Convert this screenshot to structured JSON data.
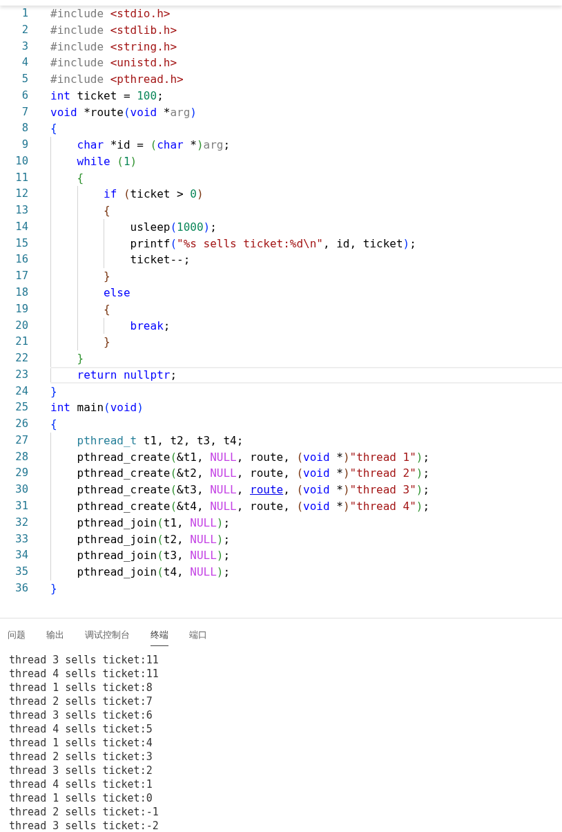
{
  "editor": {
    "lines": [
      {
        "number": "1",
        "current": false,
        "tokens": [
          {
            "kind": "pre",
            "text": "#include "
          },
          {
            "kind": "hdr",
            "text": "<stdio.h>"
          }
        ]
      },
      {
        "number": "2",
        "current": false,
        "tokens": [
          {
            "kind": "pre",
            "text": "#include "
          },
          {
            "kind": "hdr",
            "text": "<stdlib.h>"
          }
        ]
      },
      {
        "number": "3",
        "current": false,
        "tokens": [
          {
            "kind": "pre",
            "text": "#include "
          },
          {
            "kind": "hdr",
            "text": "<string.h>"
          }
        ]
      },
      {
        "number": "4",
        "current": false,
        "tokens": [
          {
            "kind": "pre",
            "text": "#include "
          },
          {
            "kind": "hdr",
            "text": "<unistd.h>"
          }
        ]
      },
      {
        "number": "5",
        "current": false,
        "tokens": [
          {
            "kind": "pre",
            "text": "#include "
          },
          {
            "kind": "hdr",
            "text": "<pthread.h>"
          }
        ]
      },
      {
        "number": "6",
        "current": false,
        "tokens": [
          {
            "kind": "kw",
            "text": "int"
          },
          {
            "kind": "plain",
            "text": " ticket = "
          },
          {
            "kind": "num",
            "text": "100"
          },
          {
            "kind": "plain",
            "text": ";"
          }
        ]
      },
      {
        "number": "7",
        "current": false,
        "tokens": [
          {
            "kind": "kw",
            "text": "void"
          },
          {
            "kind": "plain",
            "text": " *route"
          },
          {
            "kind": "b1",
            "text": "("
          },
          {
            "kind": "kw",
            "text": "void"
          },
          {
            "kind": "plain",
            "text": " *"
          },
          {
            "kind": "param",
            "text": "arg"
          },
          {
            "kind": "b1",
            "text": ")"
          }
        ]
      },
      {
        "number": "8",
        "current": false,
        "tokens": [
          {
            "kind": "b1",
            "text": "{"
          }
        ]
      },
      {
        "number": "9",
        "current": false,
        "tokens": [
          {
            "kind": "kw",
            "text": "    char"
          },
          {
            "kind": "plain",
            "text": " *id = "
          },
          {
            "kind": "b2",
            "text": "("
          },
          {
            "kind": "kw",
            "text": "char"
          },
          {
            "kind": "plain",
            "text": " *"
          },
          {
            "kind": "b2",
            "text": ")"
          },
          {
            "kind": "param",
            "text": "arg"
          },
          {
            "kind": "plain",
            "text": ";"
          }
        ]
      },
      {
        "number": "10",
        "current": false,
        "tokens": [
          {
            "kind": "kw",
            "text": "    while "
          },
          {
            "kind": "b2",
            "text": "("
          },
          {
            "kind": "num",
            "text": "1"
          },
          {
            "kind": "b2",
            "text": ")"
          }
        ]
      },
      {
        "number": "11",
        "current": false,
        "tokens": [
          {
            "kind": "b2",
            "text": "    {"
          }
        ]
      },
      {
        "number": "12",
        "current": false,
        "tokens": [
          {
            "kind": "kw",
            "text": "        if "
          },
          {
            "kind": "b3",
            "text": "("
          },
          {
            "kind": "plain",
            "text": "ticket > "
          },
          {
            "kind": "num",
            "text": "0"
          },
          {
            "kind": "b3",
            "text": ")"
          }
        ]
      },
      {
        "number": "13",
        "current": false,
        "tokens": [
          {
            "kind": "b3",
            "text": "        {"
          }
        ]
      },
      {
        "number": "14",
        "current": false,
        "tokens": [
          {
            "kind": "plain",
            "text": "            usleep"
          },
          {
            "kind": "b1",
            "text": "("
          },
          {
            "kind": "num",
            "text": "1000"
          },
          {
            "kind": "b1",
            "text": ")"
          },
          {
            "kind": "plain",
            "text": ";"
          }
        ]
      },
      {
        "number": "15",
        "current": false,
        "tokens": [
          {
            "kind": "plain",
            "text": "            printf"
          },
          {
            "kind": "b1",
            "text": "("
          },
          {
            "kind": "str",
            "text": "\"%s sells ticket:%d\\n\""
          },
          {
            "kind": "plain",
            "text": ", id, ticket"
          },
          {
            "kind": "b1",
            "text": ")"
          },
          {
            "kind": "plain",
            "text": ";"
          }
        ]
      },
      {
        "number": "16",
        "current": false,
        "tokens": [
          {
            "kind": "plain",
            "text": "            ticket--;"
          }
        ]
      },
      {
        "number": "17",
        "current": false,
        "tokens": [
          {
            "kind": "b3",
            "text": "        }"
          }
        ]
      },
      {
        "number": "18",
        "current": false,
        "tokens": [
          {
            "kind": "kw",
            "text": "        else"
          }
        ]
      },
      {
        "number": "19",
        "current": false,
        "tokens": [
          {
            "kind": "b3",
            "text": "        {"
          }
        ]
      },
      {
        "number": "20",
        "current": false,
        "tokens": [
          {
            "kind": "kw",
            "text": "            break"
          },
          {
            "kind": "plain",
            "text": ";"
          }
        ]
      },
      {
        "number": "21",
        "current": false,
        "tokens": [
          {
            "kind": "b3",
            "text": "        }"
          }
        ]
      },
      {
        "number": "22",
        "current": false,
        "tokens": [
          {
            "kind": "b2",
            "text": "    }"
          }
        ]
      },
      {
        "number": "23",
        "current": true,
        "tokens": [
          {
            "kind": "kw",
            "text": "    return "
          },
          {
            "kind": "kw",
            "text": "nullptr"
          },
          {
            "kind": "plain",
            "text": ";"
          }
        ]
      },
      {
        "number": "24",
        "current": false,
        "tokens": [
          {
            "kind": "b1",
            "text": "}"
          }
        ]
      },
      {
        "number": "25",
        "current": false,
        "tokens": [
          {
            "kind": "kw",
            "text": "int"
          },
          {
            "kind": "plain",
            "text": " main"
          },
          {
            "kind": "b1",
            "text": "("
          },
          {
            "kind": "kw",
            "text": "void"
          },
          {
            "kind": "b1",
            "text": ")"
          }
        ]
      },
      {
        "number": "26",
        "current": false,
        "tokens": [
          {
            "kind": "b1",
            "text": "{"
          }
        ]
      },
      {
        "number": "27",
        "current": false,
        "tokens": [
          {
            "kind": "type",
            "text": "    pthread_t"
          },
          {
            "kind": "plain",
            "text": " t1, t2, t3, t4;"
          }
        ]
      },
      {
        "number": "28",
        "current": false,
        "tokens": [
          {
            "kind": "plain",
            "text": "    pthread_create"
          },
          {
            "kind": "b2",
            "text": "("
          },
          {
            "kind": "plain",
            "text": "&t1, "
          },
          {
            "kind": "macro",
            "text": "NULL"
          },
          {
            "kind": "plain",
            "text": ", route, "
          },
          {
            "kind": "b3",
            "text": "("
          },
          {
            "kind": "kw",
            "text": "void"
          },
          {
            "kind": "plain",
            "text": " *"
          },
          {
            "kind": "b3",
            "text": ")"
          },
          {
            "kind": "str",
            "text": "\"thread 1\""
          },
          {
            "kind": "b2",
            "text": ")"
          },
          {
            "kind": "plain",
            "text": ";"
          }
        ]
      },
      {
        "number": "29",
        "current": false,
        "tokens": [
          {
            "kind": "plain",
            "text": "    pthread_create"
          },
          {
            "kind": "b2",
            "text": "("
          },
          {
            "kind": "plain",
            "text": "&t2, "
          },
          {
            "kind": "macro",
            "text": "NULL"
          },
          {
            "kind": "plain",
            "text": ", route, "
          },
          {
            "kind": "b3",
            "text": "("
          },
          {
            "kind": "kw",
            "text": "void"
          },
          {
            "kind": "plain",
            "text": " *"
          },
          {
            "kind": "b3",
            "text": ")"
          },
          {
            "kind": "str",
            "text": "\"thread 2\""
          },
          {
            "kind": "b2",
            "text": ")"
          },
          {
            "kind": "plain",
            "text": ";"
          }
        ]
      },
      {
        "number": "30",
        "current": false,
        "tokens": [
          {
            "kind": "plain",
            "text": "    pthread_create"
          },
          {
            "kind": "b2",
            "text": "("
          },
          {
            "kind": "plain",
            "text": "&t3, "
          },
          {
            "kind": "macro",
            "text": "NULL"
          },
          {
            "kind": "plain",
            "text": ", "
          },
          {
            "kind": "link",
            "text": "route"
          },
          {
            "kind": "plain",
            "text": ", "
          },
          {
            "kind": "b3",
            "text": "("
          },
          {
            "kind": "kw",
            "text": "void"
          },
          {
            "kind": "plain",
            "text": " *"
          },
          {
            "kind": "b3",
            "text": ")"
          },
          {
            "kind": "str",
            "text": "\"thread 3\""
          },
          {
            "kind": "b2",
            "text": ")"
          },
          {
            "kind": "plain",
            "text": ";"
          }
        ]
      },
      {
        "number": "31",
        "current": false,
        "tokens": [
          {
            "kind": "plain",
            "text": "    pthread_create"
          },
          {
            "kind": "b2",
            "text": "("
          },
          {
            "kind": "plain",
            "text": "&t4, "
          },
          {
            "kind": "macro",
            "text": "NULL"
          },
          {
            "kind": "plain",
            "text": ", route, "
          },
          {
            "kind": "b3",
            "text": "("
          },
          {
            "kind": "kw",
            "text": "void"
          },
          {
            "kind": "plain",
            "text": " *"
          },
          {
            "kind": "b3",
            "text": ")"
          },
          {
            "kind": "str",
            "text": "\"thread 4\""
          },
          {
            "kind": "b2",
            "text": ")"
          },
          {
            "kind": "plain",
            "text": ";"
          }
        ]
      },
      {
        "number": "32",
        "current": false,
        "tokens": [
          {
            "kind": "plain",
            "text": "    pthread_join"
          },
          {
            "kind": "b2",
            "text": "("
          },
          {
            "kind": "plain",
            "text": "t1, "
          },
          {
            "kind": "macro",
            "text": "NULL"
          },
          {
            "kind": "b2",
            "text": ")"
          },
          {
            "kind": "plain",
            "text": ";"
          }
        ]
      },
      {
        "number": "33",
        "current": false,
        "tokens": [
          {
            "kind": "plain",
            "text": "    pthread_join"
          },
          {
            "kind": "b2",
            "text": "("
          },
          {
            "kind": "plain",
            "text": "t2, "
          },
          {
            "kind": "macro",
            "text": "NULL"
          },
          {
            "kind": "b2",
            "text": ")"
          },
          {
            "kind": "plain",
            "text": ";"
          }
        ]
      },
      {
        "number": "34",
        "current": false,
        "tokens": [
          {
            "kind": "plain",
            "text": "    pthread_join"
          },
          {
            "kind": "b2",
            "text": "("
          },
          {
            "kind": "plain",
            "text": "t3, "
          },
          {
            "kind": "macro",
            "text": "NULL"
          },
          {
            "kind": "b2",
            "text": ")"
          },
          {
            "kind": "plain",
            "text": ";"
          }
        ]
      },
      {
        "number": "35",
        "current": false,
        "tokens": [
          {
            "kind": "plain",
            "text": "    pthread_join"
          },
          {
            "kind": "b2",
            "text": "("
          },
          {
            "kind": "plain",
            "text": "t4, "
          },
          {
            "kind": "macro",
            "text": "NULL"
          },
          {
            "kind": "b2",
            "text": ")"
          },
          {
            "kind": "plain",
            "text": ";"
          }
        ]
      },
      {
        "number": "36",
        "current": false,
        "tokens": [
          {
            "kind": "b1",
            "text": "}"
          }
        ]
      }
    ]
  },
  "panel": {
    "tabs": [
      {
        "label": "问题",
        "selected": false
      },
      {
        "label": "输出",
        "selected": false
      },
      {
        "label": "调试控制台",
        "selected": false
      },
      {
        "label": "终端",
        "selected": true
      },
      {
        "label": "端口",
        "selected": false
      }
    ],
    "terminal_lines": [
      "thread 3 sells ticket:11",
      "thread 4 sells ticket:11",
      "thread 1 sells ticket:8",
      "thread 2 sells ticket:7",
      "thread 3 sells ticket:6",
      "thread 4 sells ticket:5",
      "thread 1 sells ticket:4",
      "thread 2 sells ticket:3",
      "thread 3 sells ticket:2",
      "thread 4 sells ticket:1",
      "thread 1 sells ticket:0",
      "thread 2 sells ticket:-1",
      "thread 3 sells ticket:-2"
    ]
  }
}
